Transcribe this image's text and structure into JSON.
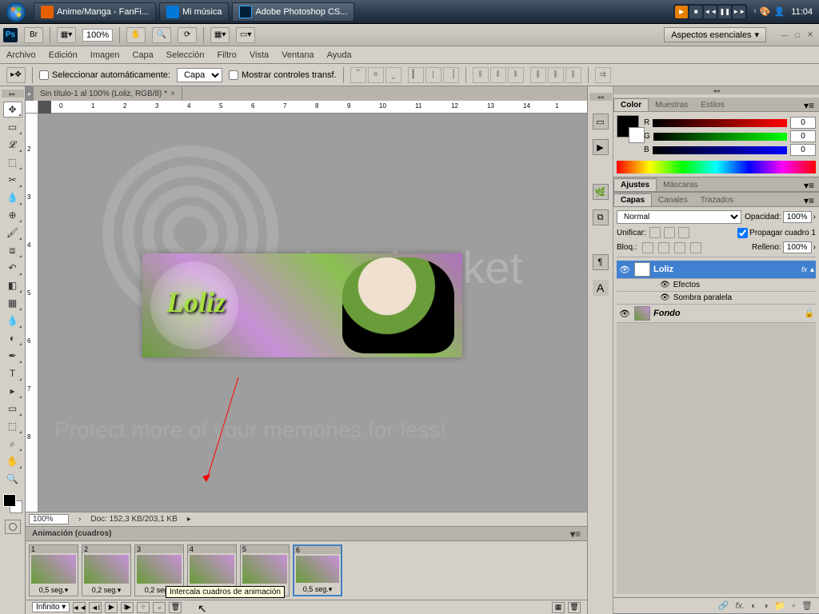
{
  "taskbar": {
    "items": [
      {
        "label": "Anime/Manga - FanFi..."
      },
      {
        "label": "Mi música"
      },
      {
        "label": "Adobe Photoshop CS..."
      }
    ],
    "clock": "11:04"
  },
  "top_toolbar": {
    "zoom": "100%"
  },
  "workspace": "Aspectos esenciales",
  "menus": [
    "Archivo",
    "Edición",
    "Imagen",
    "Capa",
    "Selección",
    "Filtro",
    "Vista",
    "Ventana",
    "Ayuda"
  ],
  "options_bar": {
    "auto_select": "Seleccionar automáticamente:",
    "auto_select_mode": "Capa",
    "show_transform": "Mostrar controles transf."
  },
  "document": {
    "tab": "Sin título-1 al 100% (Loliz, RGB/8) *",
    "artwork_text": "Loliz"
  },
  "watermark": {
    "brand": "photobucket",
    "tagline": "Protect more of your memories for less!"
  },
  "rulers": {
    "h": [
      "0",
      "1",
      "2",
      "3",
      "4",
      "5",
      "6",
      "7",
      "8",
      "9",
      "10",
      "11",
      "12",
      "13",
      "14",
      "1"
    ],
    "v": [
      "2",
      "3",
      "4",
      "5",
      "6",
      "7",
      "8"
    ]
  },
  "status": {
    "zoom": "100%",
    "doc_info": "Doc: 152,3 KB/203,1 KB"
  },
  "animation": {
    "title": "Animación (cuadros)",
    "frames": [
      {
        "num": "1",
        "delay": "0,5 seg."
      },
      {
        "num": "2",
        "delay": "0,2 seg."
      },
      {
        "num": "3",
        "delay": "0,2 seg."
      },
      {
        "num": "4",
        "delay": ""
      },
      {
        "num": "5",
        "delay": ""
      },
      {
        "num": "6",
        "delay": "0,5 seg."
      }
    ],
    "tooltip": "Intercala cuadros de animación",
    "loop": "Infinito"
  },
  "color_panel": {
    "tabs": [
      "Color",
      "Muestras",
      "Estilos"
    ],
    "r": "0",
    "g": "0",
    "b": "0"
  },
  "adjustments_panel": {
    "tabs": [
      "Ajustes",
      "Máscaras"
    ]
  },
  "layers_panel": {
    "tabs": [
      "Capas",
      "Canales",
      "Trazados"
    ],
    "blend_mode": "Normal",
    "opacity_label": "Opacidad:",
    "opacity": "100%",
    "unify_label": "Unificar:",
    "propagate": "Propagar cuadro 1",
    "lock_label": "Bloq.:",
    "fill_label": "Relleno:",
    "fill": "100%",
    "layers": [
      {
        "name": "Loliz",
        "type": "T",
        "fx": "fx"
      },
      {
        "name": "Fondo",
        "type": "bg"
      }
    ],
    "effects_label": "Efectos",
    "dropshadow_label": "Sombra paralela"
  }
}
